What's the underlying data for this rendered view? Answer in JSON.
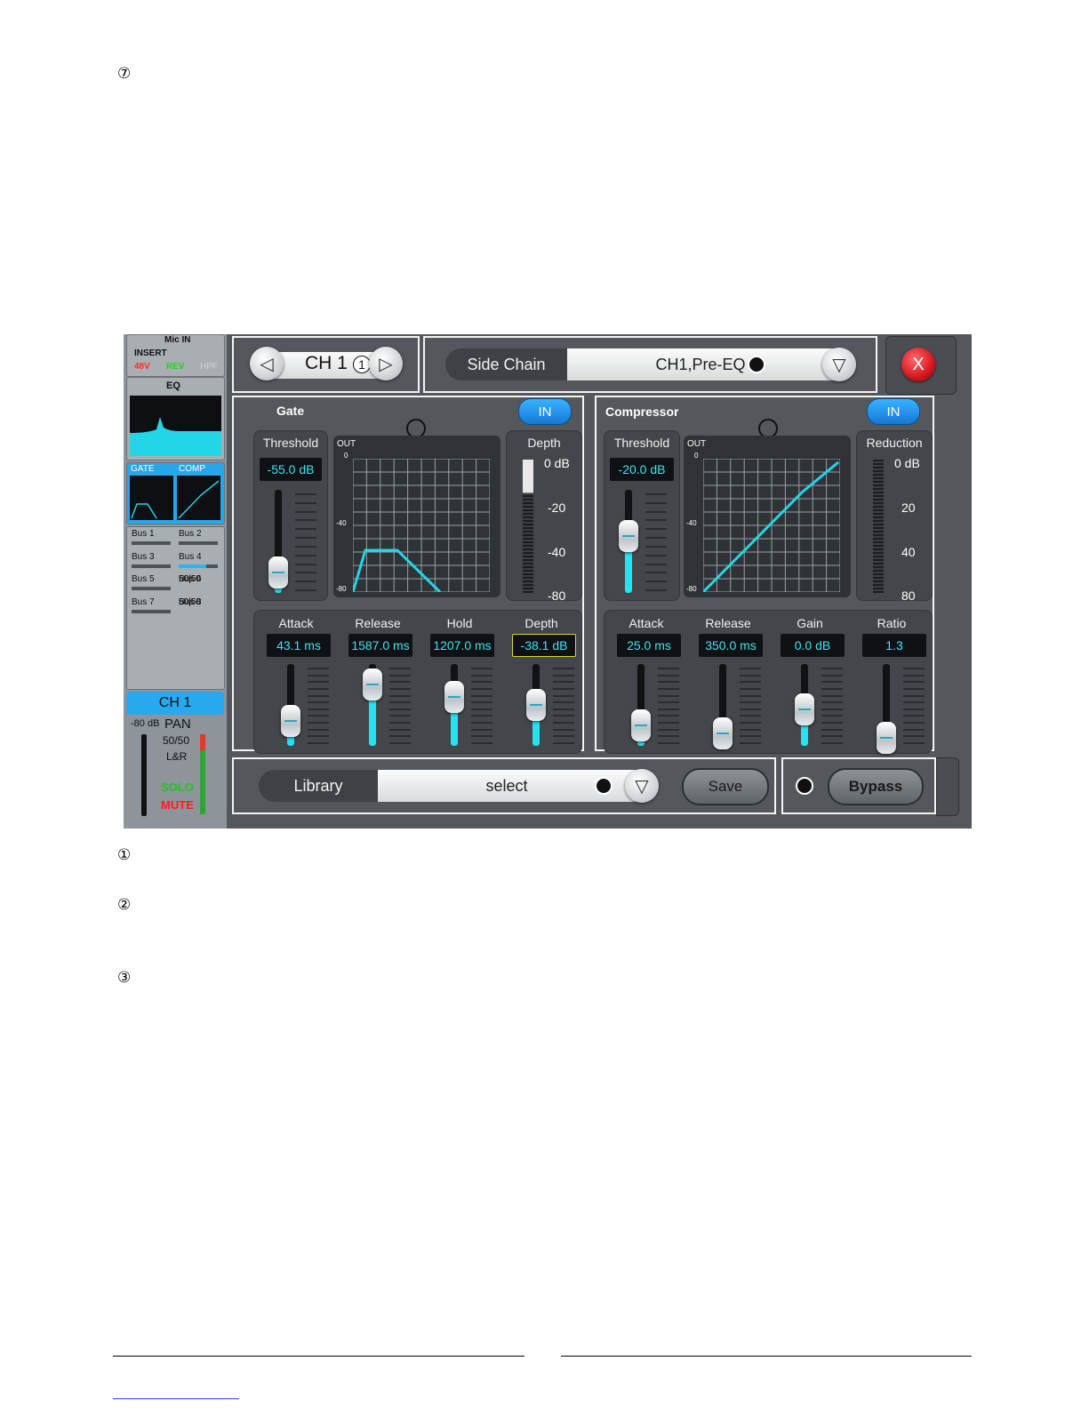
{
  "doc": {
    "marker_top": "⑦",
    "marker_1": "①",
    "marker_2": "②",
    "marker_3": "③"
  },
  "sidebar": {
    "input_title": "Mic IN",
    "insert": "INSERT",
    "flag_48v": "48V",
    "flag_rev": "REV",
    "flag_hpf": "HPF",
    "eq_title": "EQ",
    "gate_label": "GATE",
    "comp_label": "COMP",
    "buses": [
      {
        "name": "Bus 1",
        "value": ""
      },
      {
        "name": "Bus 2",
        "value": ""
      },
      {
        "name": "Bus 3",
        "value": ""
      },
      {
        "name": "Bus 4",
        "value": ""
      },
      {
        "name": "Bus 5",
        "value": "50|50"
      },
      {
        "name": "Bus 6",
        "value": "50|50"
      },
      {
        "name": "Bus 7",
        "value": "50|50"
      },
      {
        "name": "Bus 8",
        "value": "50|50"
      }
    ],
    "channel": "CH 1",
    "level": "-80 dB",
    "pan_label": "PAN",
    "pan_value": "50/50",
    "pan_mode": "L&R",
    "solo": "SOLO",
    "mute": "MUTE"
  },
  "header": {
    "channel": "CH 1",
    "marker": "1",
    "sidechain_label": "Side Chain",
    "sidechain_value": "CH1,Pre-EQ",
    "close": "X"
  },
  "gate": {
    "title": "Gate",
    "in_label": "IN",
    "threshold_label": "Threshold",
    "threshold_value": "-55.0 dB",
    "threshold_level": 0.2,
    "graph_out": "OUT",
    "graph_ticks": [
      "0",
      "-40",
      "-80"
    ],
    "depth_label": "Depth",
    "depth_scale": [
      "0 dB",
      "-20",
      "-40",
      "-80"
    ],
    "params": [
      {
        "label": "Attack",
        "value": "43.1 ms",
        "level": 0.3
      },
      {
        "label": "Release",
        "value": "1587.0 ms",
        "level": 0.75
      },
      {
        "label": "Hold",
        "value": "1207.0 ms",
        "level": 0.6
      },
      {
        "label": "Depth",
        "value": "-38.1 dB",
        "level": 0.5
      }
    ]
  },
  "compressor": {
    "title": "Compressor",
    "in_label": "IN",
    "threshold_label": "Threshold",
    "threshold_value": "-20.0 dB",
    "threshold_level": 0.55,
    "graph_out": "OUT",
    "graph_ticks": [
      "0",
      "-40",
      "-80"
    ],
    "reduction_label": "Reduction",
    "reduction_scale": [
      "0 dB",
      "20",
      "40",
      "80"
    ],
    "params": [
      {
        "label": "Attack",
        "value": "25.0 ms",
        "level": 0.25
      },
      {
        "label": "Release",
        "value": "350.0 ms",
        "level": 0.15
      },
      {
        "label": "Gain",
        "value": "0.0 dB",
        "level": 0.45
      },
      {
        "label": "Ratio",
        "value": "1.3",
        "level": 0.1
      }
    ]
  },
  "footer": {
    "library_label": "Library",
    "library_value": "select",
    "save_label": "Save",
    "bypass_label": "Bypass"
  },
  "colors": {
    "accent": "#29e0ee",
    "in_button": "#1e90ff",
    "close": "#e0141e",
    "solo": "#22c322",
    "mute": "#ff1a1a"
  }
}
